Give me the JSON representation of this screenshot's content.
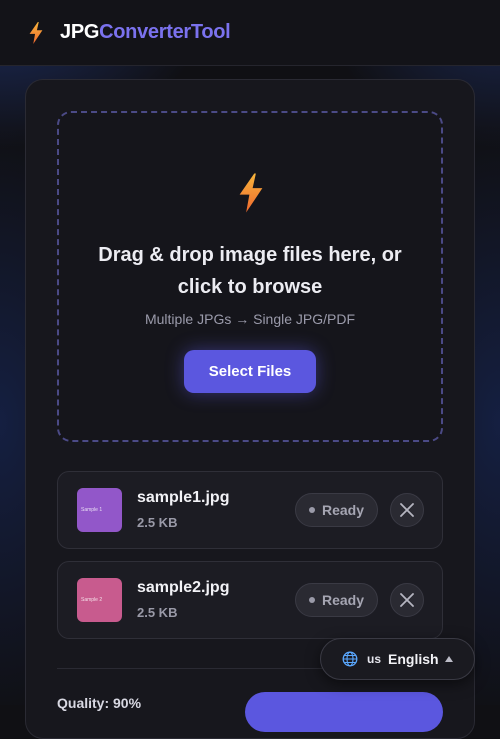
{
  "header": {
    "brand_part1": "JPG",
    "brand_part2": "ConverterTool",
    "logo_icon": "lightning-bolt-icon"
  },
  "colors": {
    "accent": "#5b57df",
    "brand_secondary": "#7b72ee",
    "bolt_top": "#f7b53c",
    "bolt_bottom": "#f0682e"
  },
  "dropzone": {
    "icon": "lightning-bolt-icon",
    "title": "Drag & drop image files here, or click to browse",
    "subtitle": "Multiple JPGs → Single JPG/PDF",
    "button_label": "Select Files"
  },
  "files": [
    {
      "name": "sample1.jpg",
      "size": "2.5 KB",
      "thumb_label": "Sample 1",
      "thumb_color": "#9257c9",
      "status": "Ready"
    },
    {
      "name": "sample2.jpg",
      "size": "2.5 KB",
      "thumb_label": "Sample 2",
      "thumb_color": "#c85b8e",
      "status": "Ready"
    }
  ],
  "options": {
    "quality_label": "Quality: 90%"
  },
  "language": {
    "code": "us",
    "name": "English",
    "icon": "globe-icon"
  }
}
